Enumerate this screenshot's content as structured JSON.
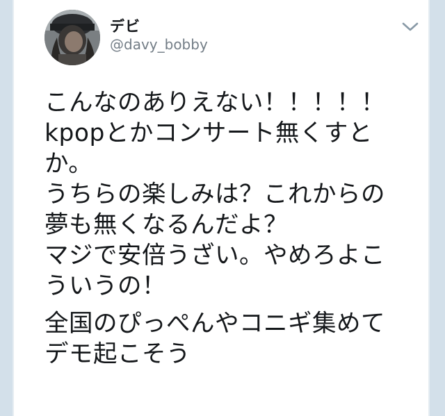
{
  "tweet": {
    "author": {
      "display_name": "デビ",
      "handle": "@davy_bobby",
      "avatar": "profile-photo"
    },
    "menu_icon": "chevron-down-icon",
    "lines_para1": [
      "こんなのありえない！！！！！",
      "kpopとかコンサート無くすと",
      "か。",
      "うちらの楽しみは？これからの",
      "夢も無くなるんだよ？",
      "マジで安倍うざい。やめろよこ",
      "ういうの！"
    ],
    "lines_para2": [
      "全国のぴっぺんやコニギ集めて",
      "デモ起こそう"
    ]
  },
  "colors": {
    "text": "#14171a",
    "handle": "#737d86",
    "background": "#d3e0ea",
    "card": "#ffffff"
  }
}
